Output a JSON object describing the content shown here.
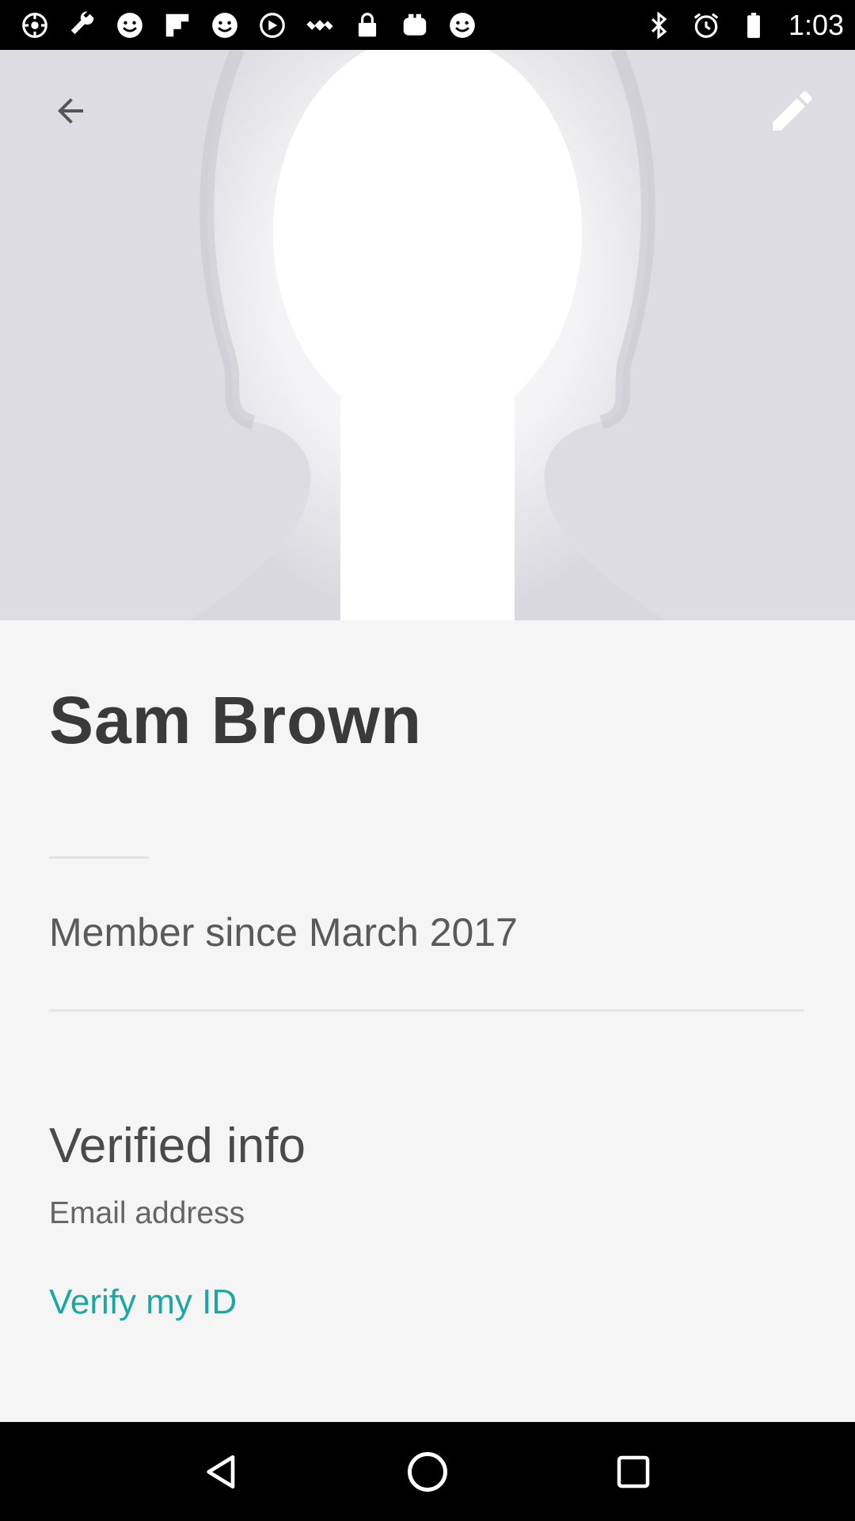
{
  "status_bar": {
    "time": "1:03",
    "left_icons": [
      "settings-icon",
      "wrench-icon",
      "smiley-icon",
      "flipboard-icon",
      "smiley-icon",
      "sync-icon",
      "satellite-fake-gps-icon",
      "lock-icon",
      "toaster-icon",
      "smiley-icon"
    ],
    "right_icons": [
      "bluetooth-icon",
      "alarm-icon",
      "battery-icon"
    ]
  },
  "header": {
    "back_icon": "arrow-left-icon",
    "edit_icon": "pencil-icon"
  },
  "profile": {
    "name": "Sam Brown",
    "member_since": "Member since March 2017"
  },
  "verified": {
    "title": "Verified info",
    "email_label": "Email address",
    "verify_link": "Verify my ID"
  },
  "nav": {
    "back": "nav-back-icon",
    "home": "nav-home-icon",
    "recents": "nav-recents-icon"
  },
  "colors": {
    "accent": "#1ba7a3",
    "hero_bg": "#dcdce2",
    "page_bg": "#f5f5f5"
  }
}
